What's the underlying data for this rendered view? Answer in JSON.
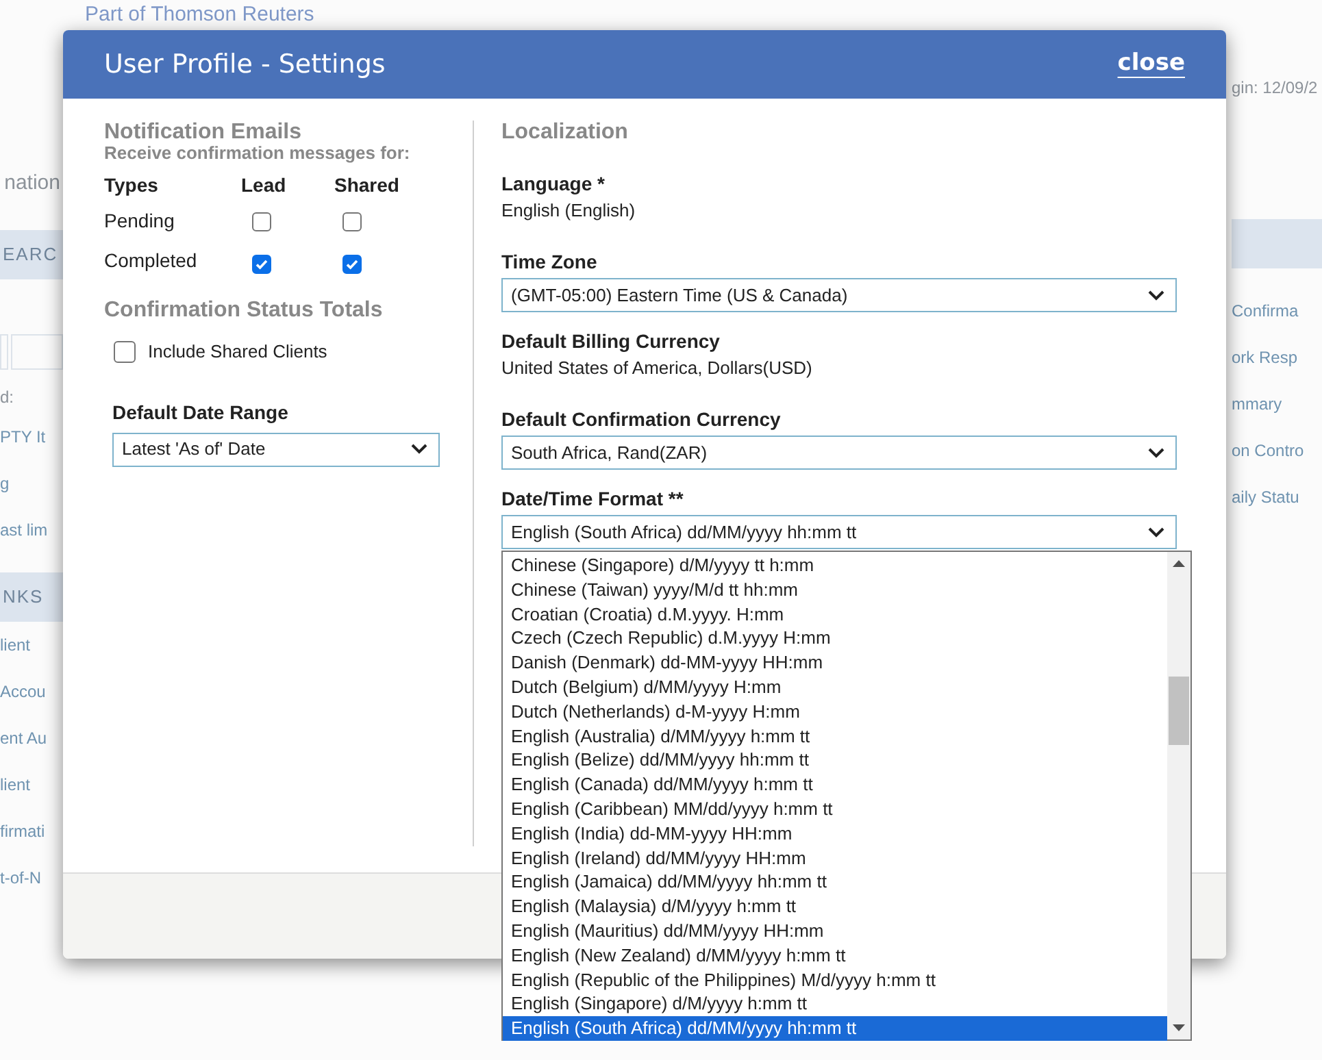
{
  "background": {
    "subtitle": "Part of Thomson Reuters",
    "left": [
      {
        "kind": "heading",
        "text": "nation"
      },
      {
        "kind": "banner",
        "text": "EARC"
      },
      {
        "kind": "inputs"
      },
      {
        "kind": "text",
        "text": "d:"
      },
      {
        "kind": "link",
        "text": "PTY It"
      },
      {
        "kind": "link",
        "text": "g"
      },
      {
        "kind": "link",
        "text": "ast lim"
      },
      {
        "kind": "banner",
        "text": "NKS"
      },
      {
        "kind": "link",
        "text": "lient"
      },
      {
        "kind": "link",
        "text": "Accou"
      },
      {
        "kind": "link",
        "text": "ent Au"
      },
      {
        "kind": "link",
        "text": "lient"
      },
      {
        "kind": "link",
        "text": "firmati"
      },
      {
        "kind": "link",
        "text": "t-of-N"
      }
    ],
    "right": [
      {
        "kind": "text",
        "text": "gin: 12/09/2"
      },
      {
        "kind": "banner"
      },
      {
        "kind": "link",
        "text": "Confirma"
      },
      {
        "kind": "link",
        "text": "ork Resp"
      },
      {
        "kind": "link",
        "text": "mmary"
      },
      {
        "kind": "link",
        "text": "on Contro"
      },
      {
        "kind": "link",
        "text": "aily Statu"
      }
    ]
  },
  "dialog": {
    "title": "User Profile - Settings",
    "close": "close",
    "notifications": {
      "heading": "Notification Emails",
      "subheading": "Receive confirmation messages for:",
      "columns": [
        "Types",
        "Lead",
        "Shared"
      ],
      "rows": [
        {
          "type": "Pending",
          "lead": false,
          "shared": false
        },
        {
          "type": "Completed",
          "lead": true,
          "shared": true
        }
      ]
    },
    "status_totals": {
      "heading": "Confirmation Status Totals",
      "include_shared": {
        "label": "Include Shared Clients",
        "checked": false
      }
    },
    "date_range": {
      "label": "Default Date Range",
      "value": "Latest 'As of' Date"
    },
    "localization": {
      "heading": "Localization",
      "fields": [
        {
          "kind": "static",
          "label": "Language *",
          "value": "English (English)"
        },
        {
          "kind": "select",
          "label": "Time Zone",
          "value": "(GMT-05:00) Eastern Time (US & Canada)"
        },
        {
          "kind": "static",
          "label": "Default Billing Currency",
          "value": "United States of America, Dollars(USD)"
        },
        {
          "kind": "select",
          "label": "Default Confirmation Currency",
          "value": "South Africa, Rand(ZAR)"
        },
        {
          "kind": "select",
          "label": "Date/Time Format **",
          "value": "English (South Africa) dd/MM/yyyy hh:mm tt",
          "open": true
        }
      ]
    },
    "format_options": [
      {
        "label": "Chinese (Singapore) d/M/yyyy tt h:mm",
        "selected": false
      },
      {
        "label": "Chinese (Taiwan) yyyy/M/d tt hh:mm",
        "selected": false
      },
      {
        "label": "Croatian (Croatia) d.M.yyyy. H:mm",
        "selected": false
      },
      {
        "label": "Czech (Czech Republic) d.M.yyyy H:mm",
        "selected": false
      },
      {
        "label": "Danish (Denmark) dd-MM-yyyy HH:mm",
        "selected": false
      },
      {
        "label": "Dutch (Belgium) d/MM/yyyy H:mm",
        "selected": false
      },
      {
        "label": "Dutch (Netherlands) d-M-yyyy H:mm",
        "selected": false
      },
      {
        "label": "English (Australia) d/MM/yyyy h:mm tt",
        "selected": false
      },
      {
        "label": "English (Belize) dd/MM/yyyy hh:mm tt",
        "selected": false
      },
      {
        "label": "English (Canada) dd/MM/yyyy h:mm tt",
        "selected": false
      },
      {
        "label": "English (Caribbean) MM/dd/yyyy h:mm tt",
        "selected": false
      },
      {
        "label": "English (India) dd-MM-yyyy HH:mm",
        "selected": false
      },
      {
        "label": "English (Ireland) dd/MM/yyyy HH:mm",
        "selected": false
      },
      {
        "label": "English (Jamaica) dd/MM/yyyy hh:mm tt",
        "selected": false
      },
      {
        "label": "English (Malaysia) d/M/yyyy h:mm tt",
        "selected": false
      },
      {
        "label": "English (Mauritius) dd/MM/yyyy HH:mm",
        "selected": false
      },
      {
        "label": "English (New Zealand) d/MM/yyyy h:mm tt",
        "selected": false
      },
      {
        "label": "English (Republic of the Philippines) M/d/yyyy h:mm tt",
        "selected": false
      },
      {
        "label": "English (Singapore) d/M/yyyy h:mm tt",
        "selected": false
      },
      {
        "label": "English (South Africa) dd/MM/yyyy hh:mm tt",
        "selected": true
      }
    ]
  }
}
